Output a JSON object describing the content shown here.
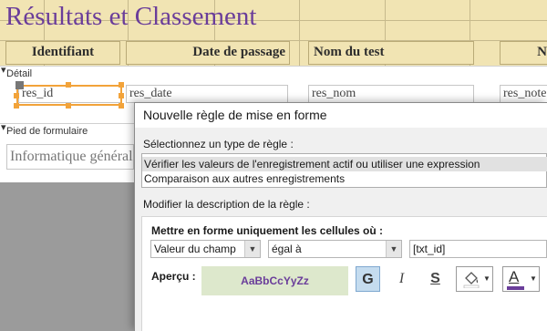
{
  "form": {
    "title": "Résultats et Classement",
    "columns": [
      "Identifiant",
      "Date de passage",
      "Nom du test",
      "N"
    ],
    "sections": {
      "detail": "Détail",
      "footer": "Pied de formulaire"
    },
    "detail_fields": [
      "res_id",
      "res_date",
      "res_nom",
      "res_note"
    ],
    "footer_field": "Informatique générale"
  },
  "dialog": {
    "title": "Nouvelle règle de mise en forme",
    "select_type_label": "Sélectionnez un type de règle :",
    "rule_types": [
      "Vérifier les valeurs de l'enregistrement actif ou utiliser une expression",
      "Comparaison aux autres enregistrements"
    ],
    "selected_rule_index": 0,
    "edit_description_label": "Modifier la description de la règle :",
    "format_only_label": "Mettre en forme uniquement les cellules où :",
    "condition": {
      "field_type": "Valeur du champ",
      "operator": "égal à",
      "value": "[txt_id]"
    },
    "preview_label": "Aperçu :",
    "preview_text": "AaBbCcYyZz",
    "format_buttons": {
      "bold": "G",
      "italic": "I",
      "underline": "S"
    },
    "colors": {
      "title_purple": "#6a3d9a",
      "header_band": "#f1e4b3",
      "preview_bg": "#dde8cc",
      "font_color_bar": "#6a3d9a",
      "selection_orange": "#f2a33a"
    }
  }
}
